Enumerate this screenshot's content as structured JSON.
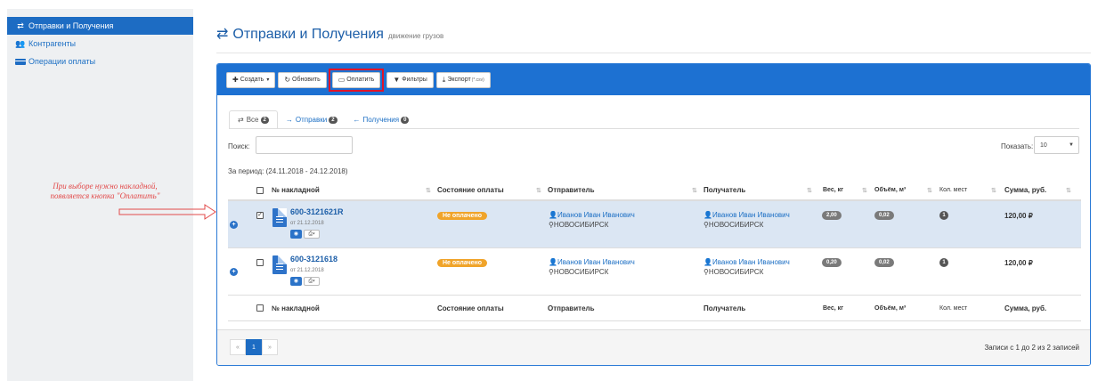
{
  "sidebar": {
    "items": [
      {
        "label": "Отправки и Получения",
        "icon": "exchange-icon",
        "active": true
      },
      {
        "label": "Контрагенты",
        "icon": "users-icon",
        "active": false
      },
      {
        "label": "Операции оплаты",
        "icon": "credit-card-icon",
        "active": false
      }
    ]
  },
  "header": {
    "title": "Отправки и Получения",
    "subtitle": "движение грузов"
  },
  "annotation": {
    "line1": "При выборе нужно накладной,",
    "line2": "появляется кнопка \"Оплатить\""
  },
  "toolbar": {
    "create_label": "Создать",
    "refresh_label": "Обновить",
    "pay_label": "Оплатить",
    "filters_label": "Фильтры",
    "export_label": "Экспорт",
    "export_format": "(*.csv)"
  },
  "tabs": [
    {
      "label": "Все",
      "count": "2"
    },
    {
      "label": "Отправки",
      "count": "2"
    },
    {
      "label": "Получения",
      "count": "0"
    }
  ],
  "search": {
    "label": "Поиск:",
    "value": ""
  },
  "page_size": {
    "label": "Показать:",
    "value": "10"
  },
  "period": "За период: (24.11.2018 - 24.12.2018)",
  "table": {
    "columns": [
      "№ накладной",
      "Состояние оплаты",
      "Отправитель",
      "Получатель",
      "Вес, кг",
      "Объём, м³",
      "Кол. мест",
      "Сумма, руб."
    ],
    "rows": [
      {
        "selected": true,
        "checked": "✓",
        "number": "600-3121621R",
        "date": "от 21.12.2018",
        "status": "Не оплачено",
        "sender_name": "Иванов Иван Иванович",
        "sender_city": "НОВОСИБИРСК",
        "receiver_name": "Иванов Иван Иванович",
        "receiver_city": "НОВОСИБИРСК",
        "weight": "2,00",
        "volume": "0,02",
        "places": "1",
        "sum": "120,00 ₽"
      },
      {
        "selected": false,
        "checked": "",
        "number": "600-3121618",
        "date": "от 21.12.2018",
        "status": "Не оплачено",
        "sender_name": "Иванов Иван Иванович",
        "sender_city": "НОВОСИБИРСК",
        "receiver_name": "Иванов Иван Иванович",
        "receiver_city": "НОВОСИБИРСК",
        "weight": "0,20",
        "volume": "0,02",
        "places": "1",
        "sum": "120,00 ₽"
      }
    ]
  },
  "pagination": {
    "prev": "«",
    "current": "1",
    "next": "»",
    "info": "Записи с 1 до 2 из 2 записей"
  },
  "colors": {
    "primary": "#1d6cc3",
    "toolbar": "#1d71d2",
    "highlight_border": "#e0142a",
    "status_unpaid": "#f0a42a",
    "annotation": "#e24a4a"
  }
}
